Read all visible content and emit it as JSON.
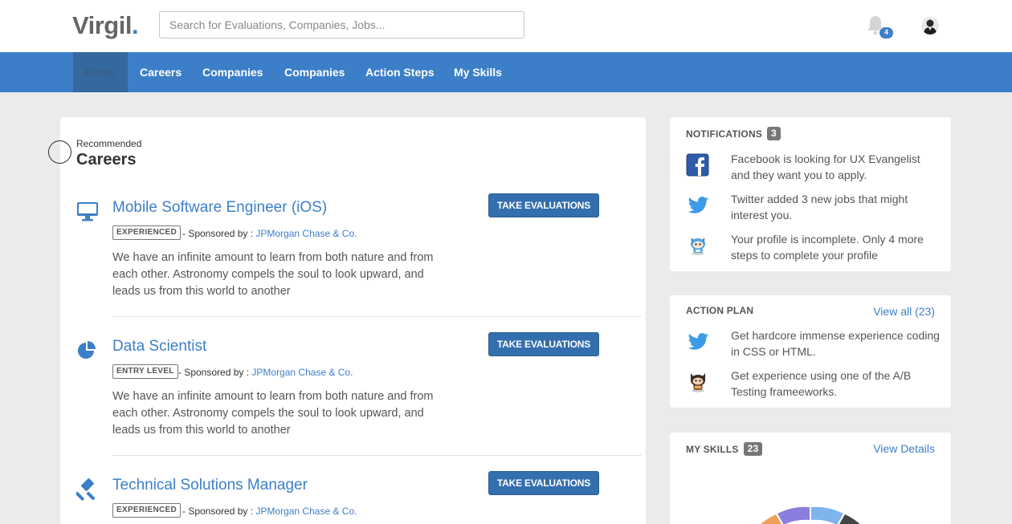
{
  "header": {
    "logo": "Virgil",
    "logo_dot": ".",
    "search_placeholder": "Search for Evaluations, Companies, Jobs...",
    "notification_count": "4"
  },
  "nav": {
    "items": [
      {
        "label": "Home",
        "active": true
      },
      {
        "label": "Careers"
      },
      {
        "label": "Companies"
      },
      {
        "label": "Companies"
      },
      {
        "label": "Action Steps"
      },
      {
        "label": "My Skills"
      }
    ]
  },
  "recommended": {
    "label": "Recommended",
    "title": "Careers",
    "button_label": "TAKE EVALUATIONS",
    "sponsored_prefix": "- Sponsored by :",
    "careers": [
      {
        "icon": "desktop-icon",
        "title": "Mobile Software Engineer (iOS)",
        "level": "EXPERIENCED",
        "sponsor": "JPMorgan Chase & Co.",
        "description": "We have an infinite amount to learn from both nature and from each other. Astronomy compels the soul to look upward, and leads us from this world to another"
      },
      {
        "icon": "pie-chart-icon",
        "title": "Data Scientist",
        "level": "ENTRY LEVEL",
        "sponsor": "JPMorgan Chase & Co.",
        "description": "We have an infinite amount to learn from both nature and from each other. Astronomy compels the soul to look upward, and leads us from this world to another"
      },
      {
        "icon": "gavel-icon",
        "title": "Technical Solutions Manager",
        "level": "EXPERIENCED",
        "sponsor": "JPMorgan Chase & Co.",
        "description": ""
      }
    ]
  },
  "notifications": {
    "title": "NOTIFICATIONS",
    "count": "3",
    "items": [
      {
        "icon": "facebook-icon",
        "text": "Facebook is looking for UX Evangelist and they want you to apply."
      },
      {
        "icon": "twitter-icon",
        "text": "Twitter added 3 new jobs that might interest you."
      },
      {
        "icon": "octocat-icon",
        "text": "Your profile is incomplete. Only 4 more steps to complete your profile"
      }
    ]
  },
  "action_plan": {
    "title": "ACTION PLAN",
    "view_all": "View all (23)",
    "items": [
      {
        "icon": "twitter-icon",
        "text": "Get hardcore immense experience coding in CSS or HTML."
      },
      {
        "icon": "octocat-icon",
        "text": "Get experience using one of the A/B Testing frameeworks."
      }
    ]
  },
  "my_skills": {
    "title": "MY SKILLS",
    "count": "23",
    "view_details": "View Details"
  },
  "colors": {
    "brand_blue": "#3c7fc8",
    "nav_active": "#34689f",
    "button_blue": "#336eae"
  }
}
